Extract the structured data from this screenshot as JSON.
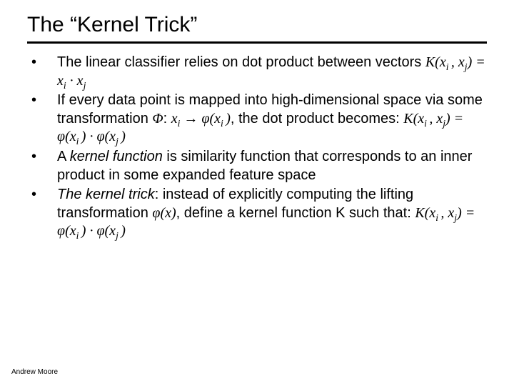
{
  "title": "The “Kernel Trick”",
  "bullets": [
    {
      "pre": "The linear classifier relies on dot product between vectors ",
      "math": "K(x<sub>i </sub>, x<sub>j</sub>) = x<sub>i</sub> · x<sub>j</sub>",
      "post": ""
    },
    {
      "pre": "If every data point is mapped into high-dimensional space via some transformation ",
      "mid_serif_ital": "Φ",
      "mid_plain": ":   ",
      "mid_math1": "x<sub>i</sub> → φ(x<sub>i </sub>)",
      "mid_plain2": ", the dot product becomes: ",
      "math": "K(x<sub>i </sub>, x<sub>j</sub>) = φ(x<sub>i </sub>) · φ(x<sub>j </sub>)",
      "post": ""
    },
    {
      "pre": "A ",
      "em": "kernel function",
      "post": " is similarity function that corresponds to an inner product in some expanded feature space"
    },
    {
      "em_lead": "The kernel trick",
      "pre": ": instead of explicitly computing the lifting transformation ",
      "mid_math1": "φ(x)",
      "mid_plain2": ", define a kernel function K such that: ",
      "math": "K(x<sub>i </sub>, x<sub>j</sub>) = φ(x<sub>i </sub>) · φ(x<sub>j </sub>)",
      "post": ""
    }
  ],
  "footer": "Andrew Moore"
}
